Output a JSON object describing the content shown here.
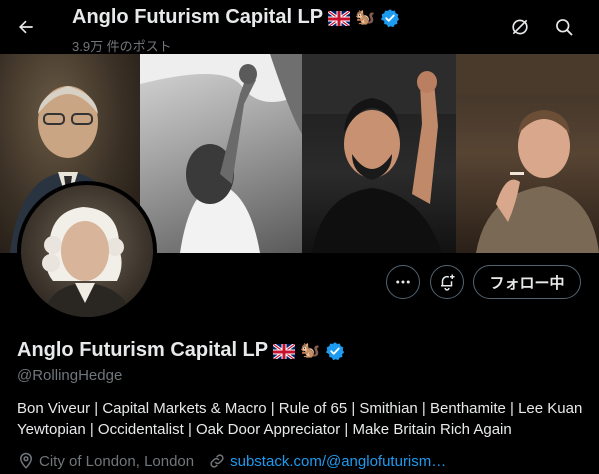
{
  "header": {
    "title": "Anglo Futurism Capital LP",
    "post_count": "3.9万 件のポスト"
  },
  "profile": {
    "name": "Anglo Futurism Capital LP",
    "handle": "@RollingHedge",
    "bio": "Bon Viveur | Capital Markets & Macro | Rule of 65 | Smithian | Benthamite | Lee Kuan Yewtopian | Occidentalist | Oak Door Appreciator | Make Britain Rich Again",
    "location": "City of London, London",
    "website": "substack.com/@anglofuturism…",
    "emoji_squirrel": "🐿️"
  },
  "actions": {
    "follow_label": "フォロー中"
  },
  "colors": {
    "background": "#000000",
    "text": "#e7e9ea",
    "muted": "#71767b",
    "link": "#1d9bf0",
    "verified": "#1d9bf0",
    "border": "#536471"
  },
  "icons": [
    "back-arrow-icon",
    "grok-icon",
    "search-icon",
    "more-icon",
    "notify-icon",
    "verified-icon",
    "location-icon",
    "link-icon",
    "uk-flag-icon"
  ]
}
